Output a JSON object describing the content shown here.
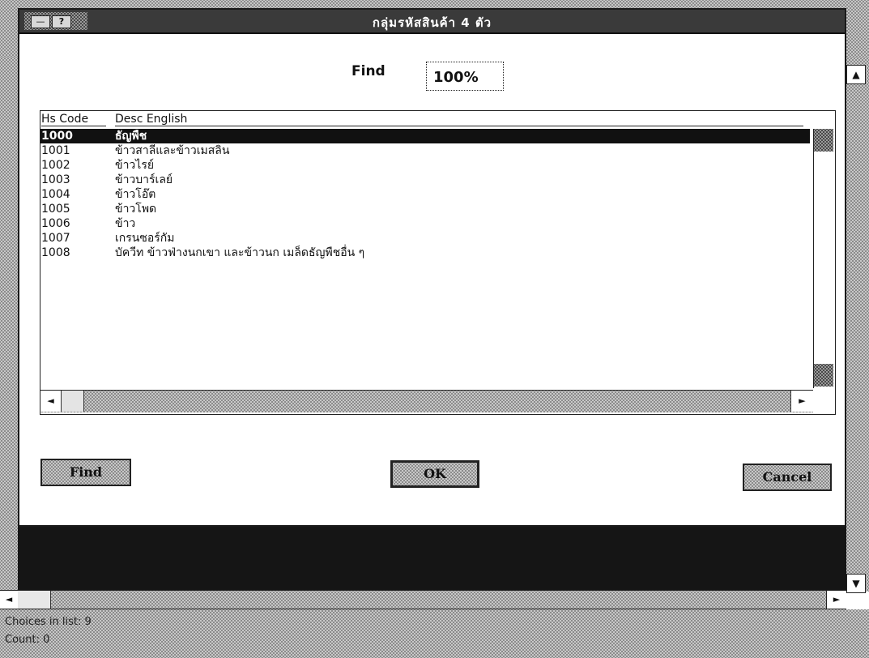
{
  "dialog": {
    "title": "กลุ่มรหัสสินค้า 4 ตัว",
    "help_glyph": "?",
    "sysmenu_glyph": "—",
    "find_label": "Find",
    "find_value": "100%"
  },
  "list": {
    "headers": {
      "code": "Hs Code",
      "desc": "Desc English"
    },
    "rows": [
      {
        "code": "1000",
        "desc": "ธัญพืช",
        "selected": true
      },
      {
        "code": "1001",
        "desc": "ข้าวสาลีและข้าวเมสลิน"
      },
      {
        "code": "1002",
        "desc": "ข้าวไรย์"
      },
      {
        "code": "1003",
        "desc": "ข้าวบาร์เลย์"
      },
      {
        "code": "1004",
        "desc": "ข้าวโอ๊ต"
      },
      {
        "code": "1005",
        "desc": "ข้าวโพด"
      },
      {
        "code": "1006",
        "desc": "ข้าว"
      },
      {
        "code": "1007",
        "desc": "เกรนซอร์กัม"
      },
      {
        "code": "1008",
        "desc": "บัควีท ข้าวฟ่างนกเขา และข้าวนก เมล็ดธัญพืชอื่น ๆ"
      }
    ]
  },
  "buttons": {
    "find": "Find",
    "ok": "OK",
    "cancel": "Cancel"
  },
  "status": {
    "choices": "Choices in list: 9",
    "count": "Count: 0"
  },
  "glyphs": {
    "arrow_left": "◄",
    "arrow_right": "►",
    "arrow_up": "▲",
    "arrow_down": "▼"
  },
  "colors": {
    "selection": "#111111",
    "titlebar": "#3a3a3a",
    "dark_band": "#151515"
  }
}
